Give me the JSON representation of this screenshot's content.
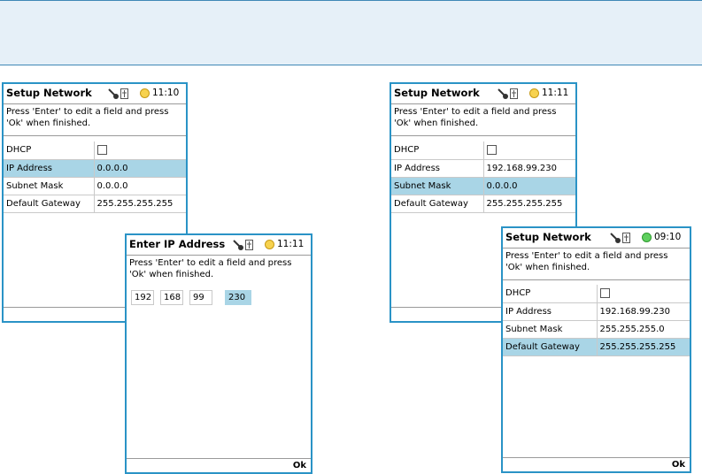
{
  "colors": {
    "frame_border": "#2a93c6",
    "selection": "#a9d5e6",
    "banner_bg": "#e6f0f8",
    "status_yellow": "#f7d24f",
    "status_green": "#5fcf5f"
  },
  "icons": [
    "key-icon",
    "usb-icon",
    "status-dot-icon",
    "checkbox-icon"
  ],
  "screen1": {
    "title": "Setup Network",
    "time": "11:10",
    "instr_line1": "Press 'Enter' to edit a field and press",
    "instr_line2": "'Ok' when finished.",
    "rows": [
      {
        "label": "DHCP",
        "value": ""
      },
      {
        "label": "IP Address",
        "value": "0.0.0.0"
      },
      {
        "label": "Subnet Mask",
        "value": "0.0.0.0"
      },
      {
        "label": "Default Gateway",
        "value": "255.255.255.255"
      }
    ],
    "selected_row": "IP Address"
  },
  "screen2": {
    "title": "Enter IP Address",
    "time": "11:11",
    "instr_line1": "Press 'Enter' to edit a field and press",
    "instr_line2": "'Ok' when finished.",
    "octets": [
      "192",
      "168",
      "99",
      "230"
    ],
    "selected_octet": "230",
    "ok_label": "Ok"
  },
  "screen3": {
    "title": "Setup Network",
    "time": "11:11",
    "instr_line1": "Press 'Enter' to edit a field and press",
    "instr_line2": "'Ok' when finished.",
    "rows": [
      {
        "label": "DHCP",
        "value": ""
      },
      {
        "label": "IP Address",
        "value": "192.168.99.230"
      },
      {
        "label": "Subnet Mask",
        "value": "0.0.0.0"
      },
      {
        "label": "Default Gateway",
        "value": "255.255.255.255"
      }
    ],
    "selected_row": "Subnet Mask"
  },
  "screen4": {
    "title": "Setup Network",
    "time": "09:10",
    "instr_line1": "Press 'Enter' to edit a field and press",
    "instr_line2": "'Ok' when finished.",
    "rows": [
      {
        "label": "DHCP",
        "value": ""
      },
      {
        "label": "IP Address",
        "value": "192.168.99.230"
      },
      {
        "label": "Subnet Mask",
        "value": "255.255.255.0"
      },
      {
        "label": "Default Gateway",
        "value": "255.255.255.255"
      }
    ],
    "selected_row": "Default Gateway",
    "ok_label": "Ok"
  }
}
